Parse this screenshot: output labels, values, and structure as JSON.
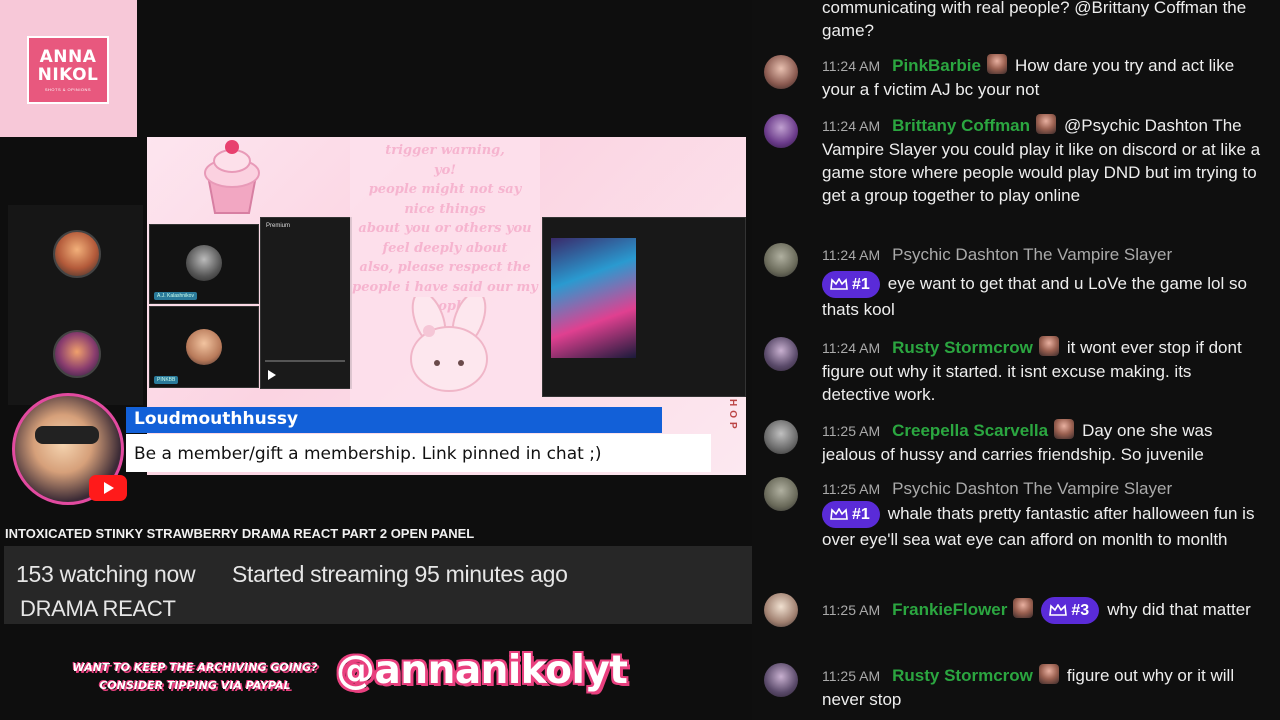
{
  "channel_logo": {
    "line1": "ANNA",
    "line2": "NIKOL",
    "line3": "SHOTS & OPINIONS"
  },
  "stage": {
    "warning_text": "trigger warning,\nyo!\npeople might not say\nnice things\nabout you or others you\nfeel deeply about\nalso, please respect the\npeople i have said our my\npeople",
    "yt_brand": "Premium",
    "side_text": "HOP",
    "cam1_tag": "A.J. Kalashnikov",
    "cam2_tag": "PINKBB"
  },
  "member_banner": {
    "name": "Loudmouthhussy",
    "message": "Be a member/gift a membership. Link pinned in chat ;)"
  },
  "stream": {
    "title": "INTOXICATED STINKY STRAWBERRY DRAMA REACT PART 2 OPEN PANEL",
    "watching": "153 watching now",
    "started": "Started streaming 95 minutes ago",
    "category": "DRAMA REACT"
  },
  "footer": {
    "tip_line1": "WANT TO KEEP THE ARCHIVING GOING?",
    "tip_line2": "CONSIDER TIPPING VIA PAYPAL",
    "handle": "@annanikolyt"
  },
  "chat": {
    "partial_text": "communicating with real people? @Brittany Coffman the game?",
    "messages": [
      {
        "time": "11:24 AM",
        "author": "PinkBarbie",
        "rank": "",
        "text": "How dare you try and act like your a f victim AJ bc your not"
      },
      {
        "time": "11:24 AM",
        "author": "Brittany Coffman",
        "rank": "",
        "text": "@Psychic Dashton The Vampire Slayer you could play it like on discord or at like a game store where people would play DND but im trying to get a group together to play online"
      },
      {
        "time": "11:24 AM",
        "author": "Psychic Dashton The Vampire Slayer",
        "rank": "#1",
        "text": "eye want to get that and u LoVe the game lol so thats kool"
      },
      {
        "time": "11:24 AM",
        "author": "Rusty Stormcrow",
        "rank": "",
        "text": "it wont ever stop if dont figure out why it started. it isnt excuse making. its detective work."
      },
      {
        "time": "11:25 AM",
        "author": "Creepella Scarvella",
        "rank": "",
        "text": "Day one she was jealous of hussy and carries friendship. So juvenile"
      },
      {
        "time": "11:25 AM",
        "author": "Psychic Dashton The Vampire Slayer",
        "rank": "#1",
        "text": "whale thats pretty fantastic after halloween fun is over eye'll sea wat eye can afford on monlth to monlth"
      },
      {
        "time": "11:25 AM",
        "author": "FrankieFlower",
        "rank": "#3",
        "text": "why did that matter"
      },
      {
        "time": "11:25 AM",
        "author": "Rusty Stormcrow",
        "rank": "",
        "text": "figure out why or it will never stop"
      }
    ]
  }
}
